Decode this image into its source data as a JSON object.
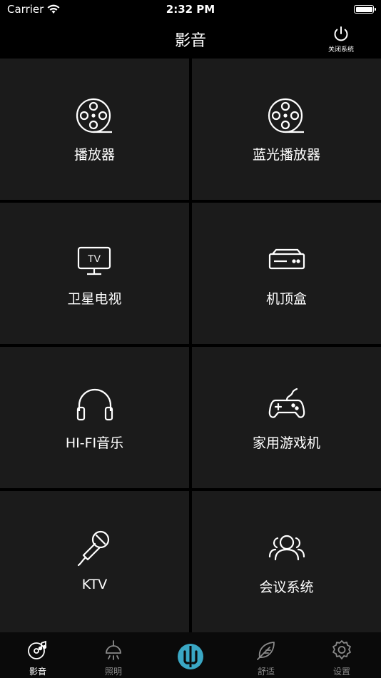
{
  "status": {
    "carrier": "Carrier",
    "time": "2:32 PM"
  },
  "nav": {
    "title": "影音",
    "power_label": "关闭系统"
  },
  "tiles": [
    {
      "label": "播放器",
      "icon": "film-reel-icon"
    },
    {
      "label": "蓝光播放器",
      "icon": "film-reel-icon"
    },
    {
      "label": "卫星电视",
      "icon": "tv-icon"
    },
    {
      "label": "机顶盒",
      "icon": "set-top-box-icon"
    },
    {
      "label": "HI-FI音乐",
      "icon": "headphones-icon"
    },
    {
      "label": "家用游戏机",
      "icon": "gamepad-icon"
    },
    {
      "label": "KTV",
      "icon": "microphone-icon"
    },
    {
      "label": "会议系统",
      "icon": "people-icon"
    }
  ],
  "tabs": [
    {
      "label": "影音",
      "icon": "music-disc-icon",
      "active": true
    },
    {
      "label": "照明",
      "icon": "ceiling-lamp-icon",
      "active": false
    },
    {
      "label": "",
      "icon": "app-logo-icon",
      "active": false
    },
    {
      "label": "舒适",
      "icon": "leaf-icon",
      "active": false
    },
    {
      "label": "设置",
      "icon": "gear-icon",
      "active": false
    }
  ],
  "colors": {
    "background": "#000000",
    "tile": "#1b1b1b",
    "accent_logo": "#3aa7c4",
    "inactive_tab": "#8a8a8a"
  }
}
